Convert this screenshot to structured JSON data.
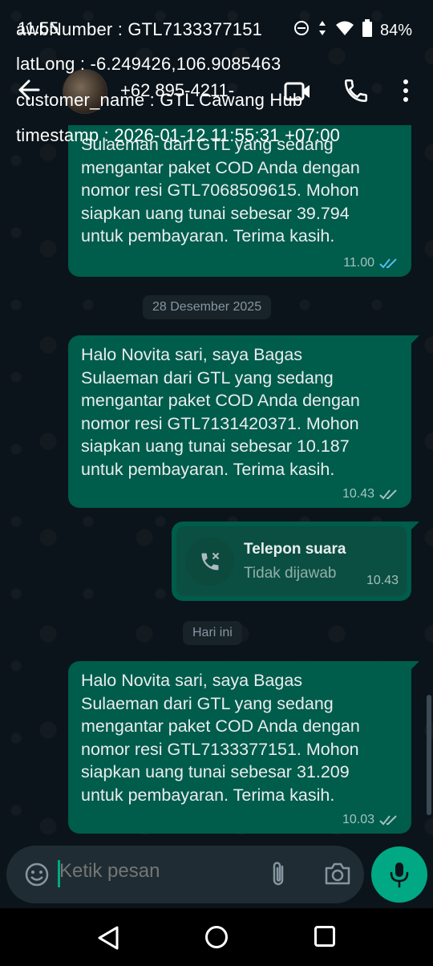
{
  "status_bar": {
    "time": "11.55",
    "battery": "84%"
  },
  "header": {
    "contact_name": "+62 895-4211-"
  },
  "overlay": {
    "line1": "awbNumber : GTL7133377151",
    "line2": "latLong : -6.249426,106.9085463",
    "line3": "customer_name : GTL Cawang Hub",
    "line4": "timestamp : 2026-01-12 11:55:31 +07:00"
  },
  "messages": [
    {
      "text": "Sulaeman dari GTL yang sedang\nmengantar paket COD Anda dengan\nnomor resi GTL7068509615. Mohon\nsiapkan uang tunai sebesar 39.794\nuntuk pembayaran. Terima kasih.",
      "time": "11.00",
      "read": true
    },
    {
      "text": "Halo Novita sari, saya Bagas\nSulaeman dari GTL yang sedang\nmengantar paket COD Anda dengan\nnomor resi GTL7131420371. Mohon\nsiapkan uang tunai sebesar 10.187\nuntuk pembayaran. Terima kasih.",
      "time": "10.43",
      "read": false
    },
    {
      "text": "Halo Novita sari, saya Bagas\nSulaeman dari GTL yang sedang\nmengantar paket COD Anda dengan\nnomor resi GTL7133377151. Mohon\nsiapkan uang tunai sebesar 31.209\nuntuk pembayaran. Terima kasih.",
      "time": "10.03",
      "read": false
    }
  ],
  "date_chips": {
    "first": "28 Desember 2025",
    "second": "Hari ini"
  },
  "call": {
    "title": "Telepon suara",
    "status": "Tidak dijawab",
    "time": "10.43"
  },
  "composer": {
    "placeholder": "Ketik pesan"
  },
  "colors": {
    "bubble": "#005c4b",
    "chat_bg": "#0b141a",
    "accent": "#00a884",
    "read_tick": "#53bdeb"
  }
}
